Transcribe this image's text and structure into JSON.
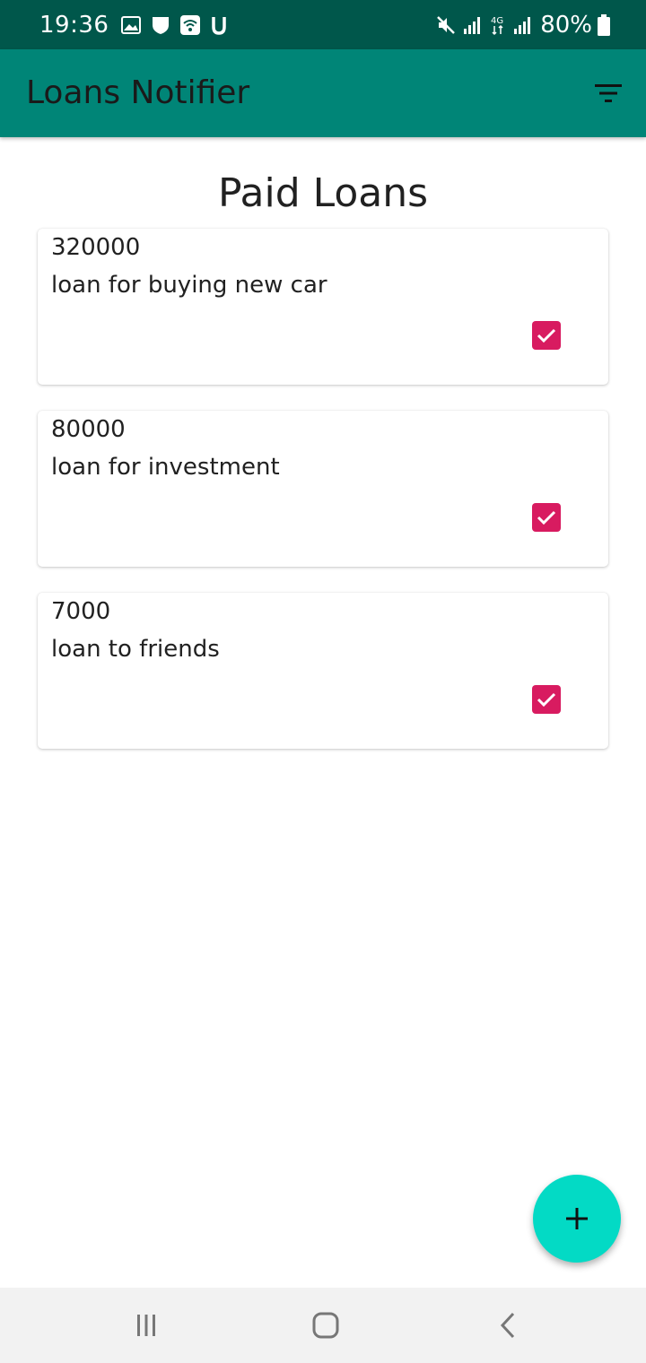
{
  "status_bar": {
    "time": "19:36",
    "battery": "80%",
    "left_icons": [
      "image-icon",
      "shield-icon",
      "wifi-calling-icon",
      "u-icon"
    ],
    "right_icons": [
      "mute-icon",
      "signal-icon",
      "4g-icon",
      "signal-icon",
      "battery-icon"
    ]
  },
  "app_bar": {
    "title": "Loans Notifier",
    "action_icon": "filter-icon",
    "color": "#008577"
  },
  "page": {
    "heading": "Paid Loans"
  },
  "loans": [
    {
      "amount": "320000",
      "description": "loan for buying new car",
      "checked": true
    },
    {
      "amount": "80000",
      "description": "loan for investment",
      "checked": true
    },
    {
      "amount": "7000",
      "description": "loan to friends",
      "checked": true
    }
  ],
  "fab": {
    "icon": "plus-icon",
    "color": "#03dac5"
  },
  "accent_color": "#d81b60",
  "nav_bar": {
    "icons": [
      "recents-icon",
      "home-icon",
      "back-icon"
    ]
  }
}
